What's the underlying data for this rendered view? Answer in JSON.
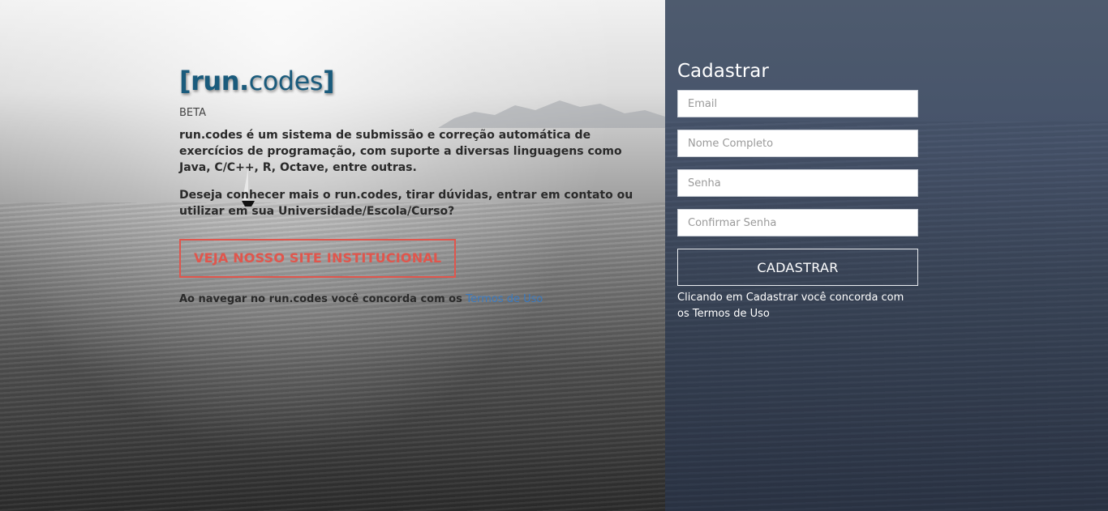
{
  "brand": {
    "logo_open": "[",
    "logo_bold": "run.",
    "logo_light": "codes",
    "logo_close": "]",
    "beta": "BETA"
  },
  "intro": {
    "description": "run.codes é um sistema de submissão e correção automática de exercícios de programação, com suporte a diversas linguagens como Java, C/C++, R, Octave, entre outras.",
    "question": "Deseja conhecer mais o run.codes, tirar dúvidas, entrar em contato ou utilizar em sua Universidade/Escola/Curso?",
    "cta_label": "VEJA NOSSO SITE INSTITUCIONAL",
    "notice_text": "Ao navegar no run.codes você concorda com os ",
    "notice_link": "Termos de Uso"
  },
  "signup": {
    "title": "Cadastrar",
    "email_placeholder": "Email",
    "name_placeholder": "Nome Completo",
    "password_placeholder": "Senha",
    "confirm_placeholder": "Confirmar Senha",
    "submit_label": "CADASTRAR",
    "notice_text": "Clicando em Cadastrar você concorda com os ",
    "notice_link": "Termos de Uso"
  },
  "colors": {
    "brand": "#1a5b7c",
    "cta": "#e0564d",
    "link": "#3a7ac0",
    "panel": "#46536a"
  }
}
